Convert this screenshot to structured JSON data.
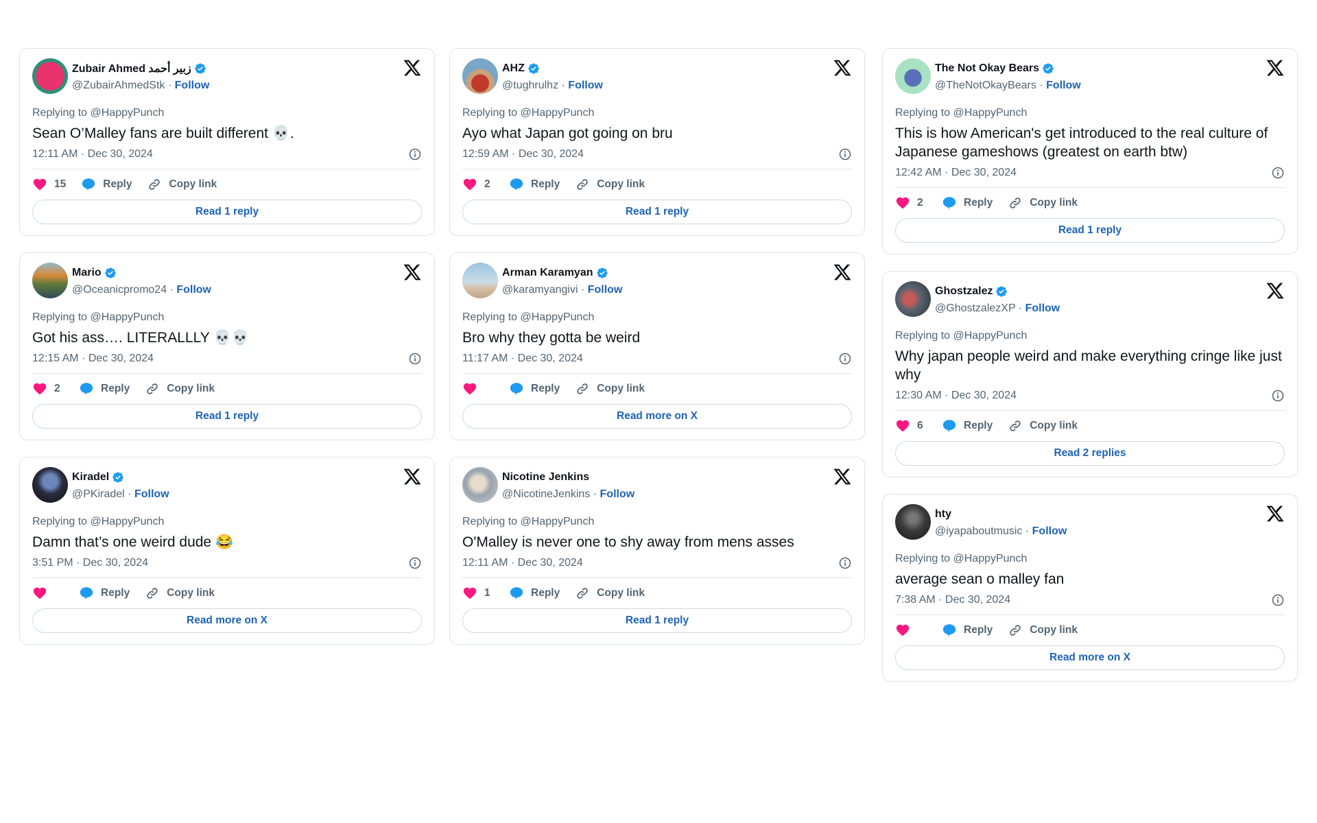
{
  "colors": {
    "like": "#f91880",
    "reply": "#1d9bf0",
    "link": "#1d63b5",
    "verified": "#1d9bf0",
    "muted": "#536471"
  },
  "common": {
    "follow_label": "Follow",
    "reply_label": "Reply",
    "copy_link_label": "Copy link",
    "replying_to": "Replying to @HappyPunch"
  },
  "tweets": [
    {
      "name": "Zubair Ahmed زبیر أحمد",
      "handle": "@ZubairAhmedStk",
      "verified": true,
      "avatar_icon": "letter-a-avatar",
      "text": "Sean O’Malley fans are built different 💀.",
      "timestamp": "12:11 AM · Dec 30, 2024",
      "likes": "15",
      "read_label": "Read 1 reply"
    },
    {
      "name": "AHZ",
      "handle": "@tughrulhz",
      "verified": true,
      "avatar_icon": "warrior-avatar",
      "text": "Ayo what Japan got going on bru",
      "timestamp": "12:59 AM · Dec 30, 2024",
      "likes": "2",
      "read_label": "Read 1 reply"
    },
    {
      "name": "The Not Okay Bears",
      "handle": "@TheNotOkayBears",
      "verified": true,
      "avatar_icon": "bear-avatar",
      "text": "This is how American's get introduced to the real culture of Japanese gameshows (greatest on earth btw)",
      "timestamp": "12:42 AM · Dec 30, 2024",
      "likes": "2",
      "read_label": "Read 1 reply"
    },
    {
      "name": "Mario",
      "handle": "@Oceanicpromo24",
      "verified": true,
      "avatar_icon": "landscape-avatar",
      "text": "Got his ass…. LITERALLLY 💀💀",
      "timestamp": "12:15 AM · Dec 30, 2024",
      "likes": "2",
      "read_label": "Read 1 reply"
    },
    {
      "name": "Arman Karamyan",
      "handle": "@karamyangivi",
      "verified": true,
      "avatar_icon": "beach-avatar",
      "text": "Bro why they gotta be weird",
      "timestamp": "11:17 AM · Dec 30, 2024",
      "likes": "",
      "read_label": "Read more on X"
    },
    {
      "name": "Ghostzalez",
      "handle": "@GhostzalezXP",
      "verified": true,
      "avatar_icon": "hand-avatar",
      "text": "Why japan people weird and make everything cringe like just why",
      "timestamp": "12:30 AM · Dec 30, 2024",
      "likes": "6",
      "read_label": "Read 2 replies"
    },
    {
      "name": "Kiradel",
      "handle": "@PKiradel",
      "verified": true,
      "avatar_icon": "anime-avatar",
      "text": "Damn that’s one weird dude 😂",
      "timestamp": "3:51 PM · Dec 30, 2024",
      "likes": "",
      "read_label": "Read more on X"
    },
    {
      "name": "Nicotine Jenkins",
      "handle": "@NicotineJenkins",
      "verified": false,
      "avatar_icon": "dog-avatar",
      "text": "O'Malley is never one to shy away from mens asses",
      "timestamp": "12:11 AM · Dec 30, 2024",
      "likes": "1",
      "read_label": "Read 1 reply"
    },
    {
      "name": "hty",
      "handle": "@iyapaboutmusic",
      "verified": false,
      "avatar_icon": "dark-photo-avatar",
      "text": "average sean o malley fan",
      "timestamp": "7:38 AM · Dec 30, 2024",
      "likes": "",
      "read_label": "Read more on X"
    }
  ]
}
